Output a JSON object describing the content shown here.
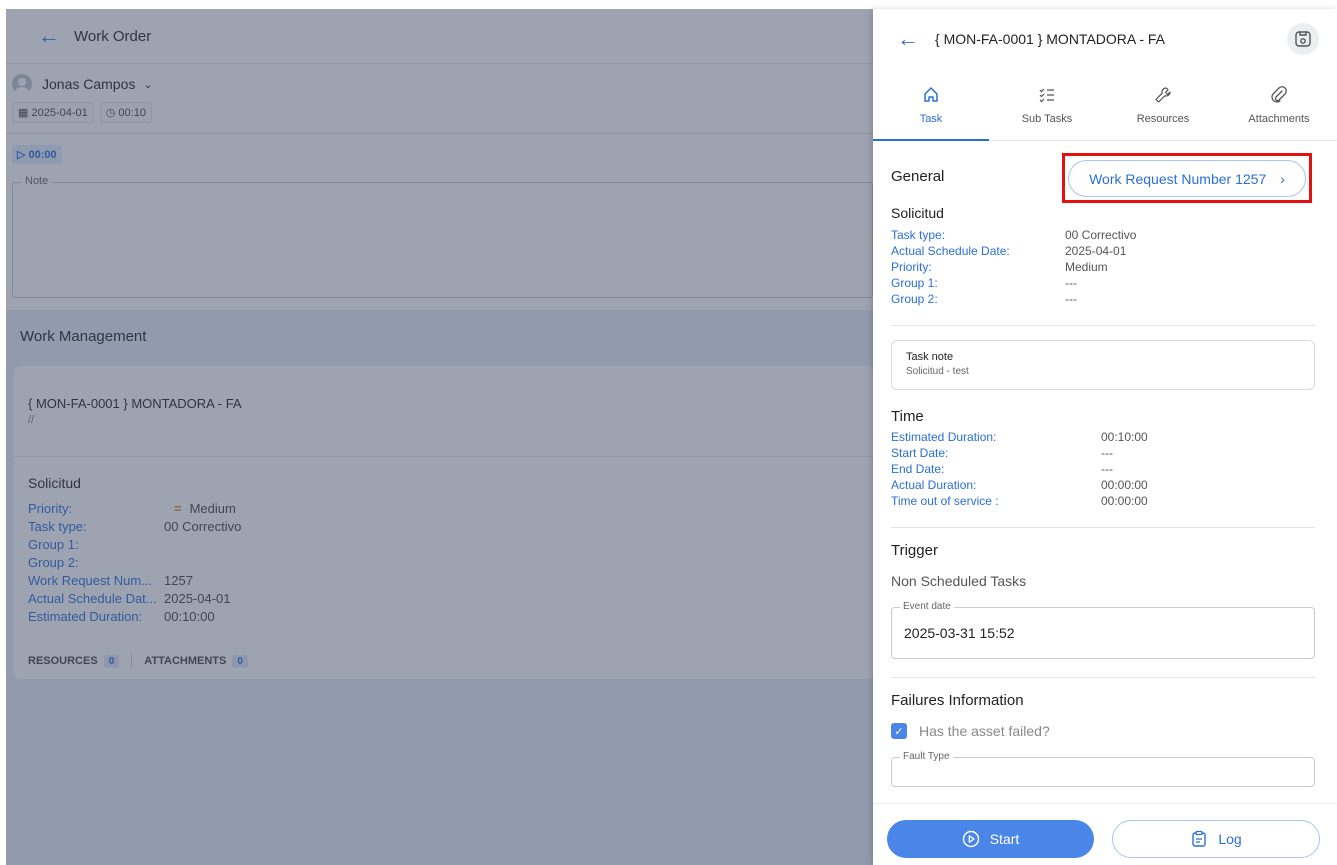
{
  "left": {
    "title": "Work Order",
    "user": "Jonas Campos",
    "date_chip": "2025-04-01",
    "duration_chip": "00:10",
    "timer": "00:00",
    "note_label": "Note",
    "wm_title": "Work Management",
    "card": {
      "title": "{ MON-FA-0001 } MONTADORA - FA",
      "sub": "//",
      "section": "Solicitud",
      "rows": [
        {
          "k": "Priority:",
          "v": "Medium"
        },
        {
          "k": "Task type:",
          "v": "00 Correctivo"
        },
        {
          "k": "Group 1:",
          "v": ""
        },
        {
          "k": "Group 2:",
          "v": ""
        },
        {
          "k": "Work Request Num...",
          "v": "1257"
        },
        {
          "k": "Actual Schedule Dat...",
          "v": "2025-04-01"
        },
        {
          "k": "Estimated Duration:",
          "v": "00:10:00"
        }
      ],
      "resources_label": "RESOURCES",
      "resources_count": "0",
      "attachments_label": "ATTACHMENTS",
      "attachments_count": "0"
    }
  },
  "right": {
    "title": "{ MON-FA-0001 } MONTADORA - FA",
    "tabs": [
      {
        "label": "Task",
        "icon": "home-icon"
      },
      {
        "label": "Sub Tasks",
        "icon": "checklist-icon"
      },
      {
        "label": "Resources",
        "icon": "wrench-icon"
      },
      {
        "label": "Attachments",
        "icon": "paperclip-icon"
      }
    ],
    "general": "General",
    "wr_button": "Work Request Number 1257",
    "solicitud": "Solicitud",
    "solicitud_rows": [
      {
        "k": "Task type:",
        "v": "00 Correctivo"
      },
      {
        "k": "Actual Schedule Date:",
        "v": "2025-04-01"
      },
      {
        "k": "Priority:",
        "v": "Medium"
      },
      {
        "k": "Group 1:",
        "v": "---"
      },
      {
        "k": "Group 2:",
        "v": "---"
      }
    ],
    "task_note_title": "Task note",
    "task_note_value": "Solicitud - test",
    "time_title": "Time",
    "time_rows": [
      {
        "k": "Estimated Duration:",
        "v": "00:10:00"
      },
      {
        "k": "Start Date:",
        "v": "---"
      },
      {
        "k": "End Date:",
        "v": "---"
      },
      {
        "k": "Actual Duration:",
        "v": "00:00:00"
      },
      {
        "k": "Time out of service :",
        "v": "00:00:00"
      }
    ],
    "trigger_title": "Trigger",
    "trigger_value": "Non Scheduled Tasks",
    "event_label": "Event date",
    "event_value": "2025-03-31 15:52",
    "failures_title": "Failures Information",
    "failed_label": "Has the asset failed?",
    "fault_label": "Fault Type",
    "start_label": "Start",
    "log_label": "Log"
  },
  "colors": {
    "accent": "#2a6fd6",
    "primary_button": "#4a86e8",
    "highlight": "#e41111"
  }
}
